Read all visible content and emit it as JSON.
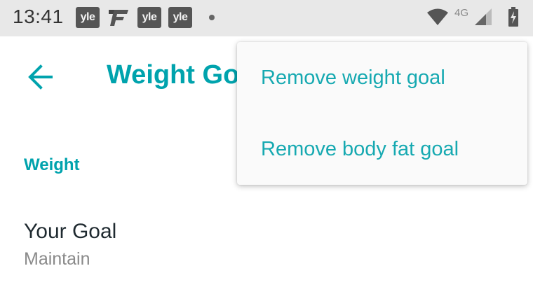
{
  "status_bar": {
    "time": "13:41",
    "notifications": [
      {
        "icon": "yle-icon",
        "text": "yle"
      },
      {
        "icon": "f-logo-icon",
        "text": ""
      },
      {
        "icon": "yle-icon",
        "text": "yle"
      },
      {
        "icon": "yle-icon",
        "text": "yle"
      }
    ],
    "network": "4G"
  },
  "app_bar": {
    "title": "Weight Goal"
  },
  "section": {
    "header": "Weight"
  },
  "goal": {
    "title": "Your Goal",
    "value": "Maintain"
  },
  "menu": {
    "items": [
      {
        "label": "Remove weight goal"
      },
      {
        "label": "Remove body fat goal"
      }
    ]
  },
  "colors": {
    "accent": "#00a3ad",
    "status_bar_bg": "#e8e8e8",
    "menu_bg": "#fafafa",
    "text_primary": "#1f2a30",
    "text_secondary": "#8a8a8a"
  }
}
